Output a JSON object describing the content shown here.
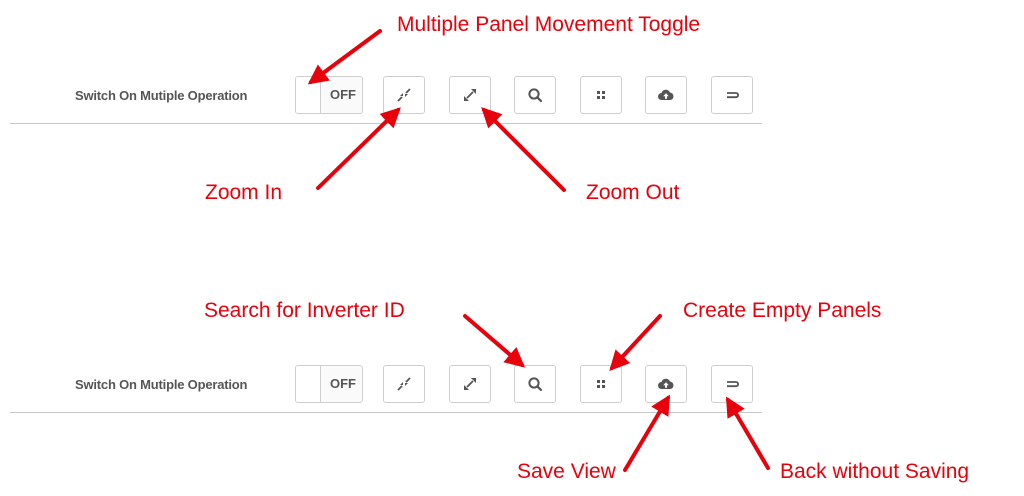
{
  "toolbar_top": {
    "label": "Switch On Mutiple Operation",
    "toggle_state": "OFF",
    "buttons": [
      "zoom-in",
      "zoom-out",
      "search",
      "create-panels",
      "save-cloud",
      "back"
    ]
  },
  "toolbar_bottom": {
    "label": "Switch On Mutiple Operation",
    "toggle_state": "OFF",
    "buttons": [
      "zoom-in",
      "zoom-out",
      "search",
      "create-panels",
      "save-cloud",
      "back"
    ]
  },
  "annotations": {
    "multiple_panel_toggle": "Multiple Panel Movement Toggle",
    "zoom_in": "Zoom In",
    "zoom_out": "Zoom Out",
    "search_inverter": "Search for Inverter ID",
    "create_empty_panels": "Create Empty Panels",
    "save_view": "Save View",
    "back_without_saving": "Back without Saving"
  },
  "colors": {
    "annotation_red": "#e8000b",
    "icon_gray": "#555555",
    "border_gray": "#cfcfcf"
  }
}
